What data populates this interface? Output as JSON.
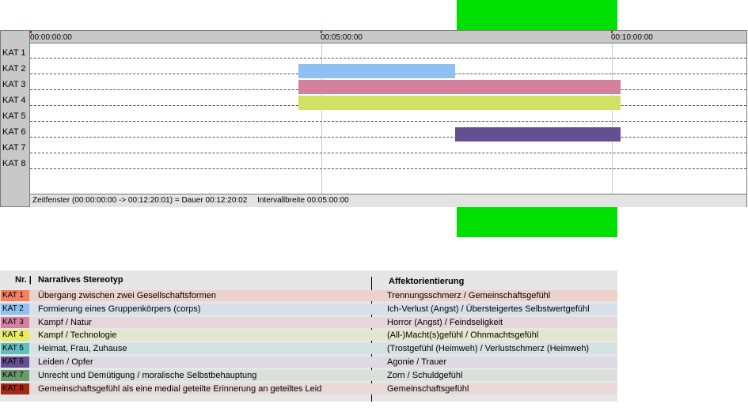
{
  "timeline": {
    "ticks": [
      "00:00:00:00",
      "00:05:00:00",
      "00:10:00:00"
    ],
    "rows": [
      "KAT 1",
      "KAT 2",
      "KAT 3",
      "KAT 4",
      "KAT 5",
      "KAT 6",
      "KAT 7",
      "KAT 8"
    ],
    "segments": [
      {
        "row": 2,
        "start_min": 4.6,
        "end_min": 7.3,
        "color": "#8fc0f2"
      },
      {
        "row": 3,
        "start_min": 4.6,
        "end_min": 10.15,
        "color": "#d4819f"
      },
      {
        "row": 4,
        "start_min": 4.6,
        "end_min": 10.15,
        "color": "#d2e065"
      },
      {
        "row": 6,
        "start_min": 7.3,
        "end_min": 10.15,
        "color": "#625092"
      }
    ],
    "status": {
      "window": "Zeitfenster (00:00:00:00 -> 00:12:20:01) = Dauer 00:12:20:02",
      "interval": "Intervallbreite 00:05:00:00"
    }
  },
  "legend": {
    "header_nr": "Nr. |",
    "header_stereotyp": "Narratives Stereotyp",
    "header_affekt": "Affektorientierung",
    "rows": [
      {
        "kat": "KAT 1",
        "swatch": "#f5805f",
        "bg": "#ebd2cc",
        "stereotyp": "Übergang zwischen zwei Gesellschaftsformen",
        "affekt": "Trennungsschmerz / Gemeinschaftsgefühl"
      },
      {
        "kat": "KAT 2",
        "swatch": "#8fc0f2",
        "bg": "#d6dfea",
        "stereotyp": "Formierung eines Gruppenkörpers (corps)",
        "affekt": "Ich-Verlust (Angst) / Übersteigertes Selbstwertgefühl"
      },
      {
        "kat": "KAT 3",
        "swatch": "#d4819f",
        "bg": "#e6d6dc",
        "stereotyp": "Kampf / Natur",
        "affekt": "Horror (Angst) / Feindseligkeit"
      },
      {
        "kat": "KAT 4",
        "swatch": "#e5eb62",
        "bg": "#e5e6cf",
        "stereotyp": "Kampf / Technologie",
        "affekt": "(All-)Macht(s)gefühl / Ohnmachtsgefühl"
      },
      {
        "kat": "KAT 5",
        "swatch": "#62bfbd",
        "bg": "#d4e3e2",
        "stereotyp": "Heimat, Frau, Zuhause",
        "affekt": "(Trostgefühl (Heimweh) / Verlustschmerz (Heimweh)"
      },
      {
        "kat": "KAT 6",
        "swatch": "#625092",
        "bg": "#dcdae2",
        "stereotyp": "Leiden / Opfer",
        "affekt": "Agonie / Trauer"
      },
      {
        "kat": "KAT 7",
        "swatch": "#6a9a6a",
        "bg": "#d9e0d9",
        "stereotyp": "Unrecht und Demütigung / moralische Selbstbehauptung",
        "affekt": "Zorn / Schuldgefühl"
      },
      {
        "kat": "KAT 8",
        "swatch": "#a82818",
        "bg": "#e9d9d9",
        "stereotyp": "Gemeinschaftsgefühl als eine medial geteilte Erinnerung an geteiltes Leid",
        "affekt": "Gemeinschaftsgefühl"
      }
    ]
  }
}
